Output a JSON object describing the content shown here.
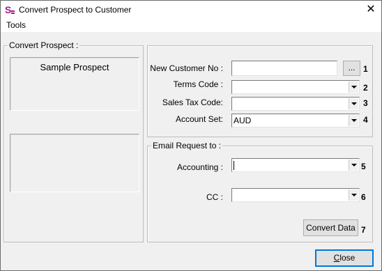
{
  "window": {
    "title": "Convert Prospect to Customer",
    "close_glyph": "✕"
  },
  "menu": {
    "tools": "Tools"
  },
  "left_panel": {
    "title": "Convert Prospect :",
    "prospect_name": "Sample Prospect"
  },
  "customer_group": {
    "new_customer_no": {
      "label": "New Customer No :",
      "value": "",
      "browse": "...",
      "num": "1"
    },
    "terms_code": {
      "label": "Terms Code :",
      "value": "",
      "num": "2"
    },
    "sales_tax_code": {
      "label": "Sales Tax Code:",
      "value": "",
      "num": "3"
    },
    "account_set": {
      "label": "Account Set:",
      "value": "AUD",
      "num": "4"
    }
  },
  "email_group": {
    "title": "Email Request to :",
    "accounting": {
      "label": "Accounting :",
      "value": "",
      "num": "5"
    },
    "cc": {
      "label": "CC :",
      "value": "",
      "num": "6"
    },
    "convert_button": "Convert Data",
    "convert_num": "7"
  },
  "footer": {
    "close_first": "C",
    "close_rest": "lose"
  },
  "colors": {
    "app_icon": "#a0198c",
    "accent": "#0078d7"
  },
  "icons": {
    "app": "app-logo-icon",
    "close": "close-icon",
    "dropdown": "chevron-down-icon"
  }
}
